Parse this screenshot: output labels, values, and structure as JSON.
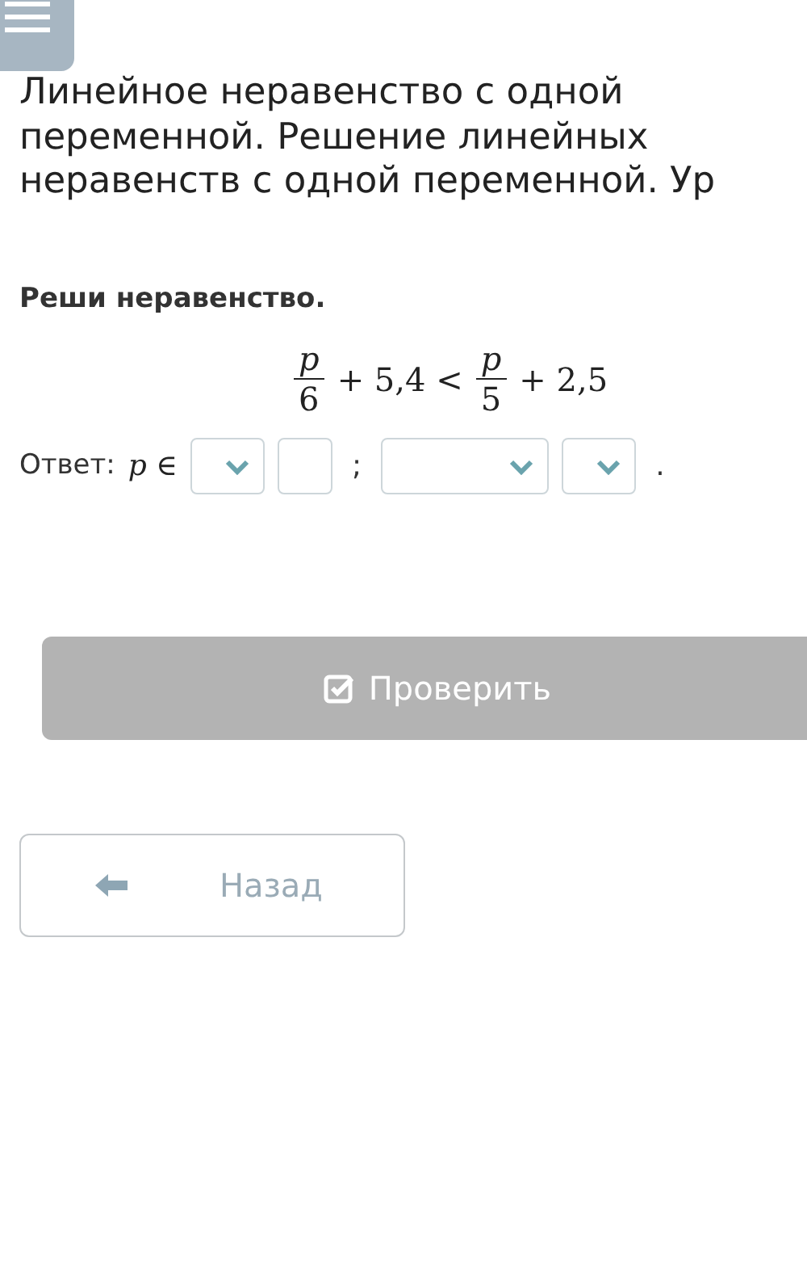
{
  "title_lines": [
    "Линейное неравенство с одной",
    "переменной. Решение линейных",
    "неравенств с одной переменной. Ур"
  ],
  "task": "Реши неравенство.",
  "equation": [
    {
      "kind": "fraction",
      "numerator": "p",
      "denominator": "6"
    },
    {
      "kind": "text",
      "text": "+ 5,4 <"
    },
    {
      "kind": "fraction",
      "numerator": "p",
      "denominator": "5"
    },
    {
      "kind": "text",
      "text": "+ 2,5"
    }
  ],
  "answer": {
    "label": "Ответ:",
    "variable": "p ∈",
    "parts": [
      {
        "kind": "select"
      },
      {
        "kind": "input"
      },
      {
        "kind": "text",
        "text": ";"
      },
      {
        "kind": "wide_select"
      },
      {
        "kind": "select"
      },
      {
        "kind": "text",
        "text": "."
      }
    ]
  },
  "check_button": {
    "label": "Проверить",
    "disabled": true
  },
  "back_button": {
    "label": "Назад"
  }
}
